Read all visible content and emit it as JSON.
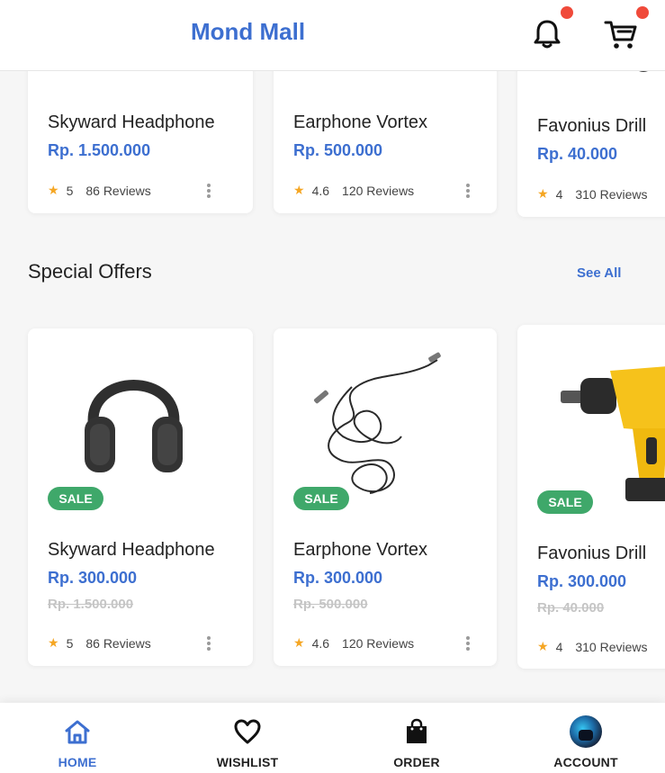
{
  "header": {
    "brand": "Mond Mall",
    "bell_icon": "bell-icon",
    "cart_icon": "cart-icon"
  },
  "top_row": [
    {
      "name": "Skyward Headphone",
      "price": "Rp. 1.500.000",
      "rating": "5",
      "reviews": "86 Reviews"
    },
    {
      "name": "Earphone Vortex",
      "price": "Rp. 500.000",
      "rating": "4.6",
      "reviews": "120 Reviews"
    },
    {
      "name": "Favonius Drill",
      "price": "Rp. 40.000",
      "rating": "4",
      "reviews": "310 Reviews"
    }
  ],
  "special_offers": {
    "title": "Special Offers",
    "see_all": "See All",
    "items": [
      {
        "badge": "SALE",
        "name": "Skyward Headphone",
        "price": "Rp. 300.000",
        "old_price": "Rp. 1.500.000",
        "rating": "5",
        "reviews": "86 Reviews"
      },
      {
        "badge": "SALE",
        "name": "Earphone Vortex",
        "price": "Rp. 300.000",
        "old_price": "Rp. 500.000",
        "rating": "4.6",
        "reviews": "120 Reviews"
      },
      {
        "badge": "SALE",
        "name": "Favonius Drill",
        "price": "Rp. 300.000",
        "old_price": "Rp. 40.000",
        "rating": "4",
        "reviews": "310 Reviews"
      }
    ]
  },
  "nav": {
    "home": "HOME",
    "wishlist": "WISHLIST",
    "order": "ORDER",
    "account": "ACCOUNT"
  },
  "colors": {
    "accent": "#3d6fd0",
    "sale": "#3fa86a",
    "badge_dot": "#f04a3a",
    "star": "#f5a623"
  }
}
